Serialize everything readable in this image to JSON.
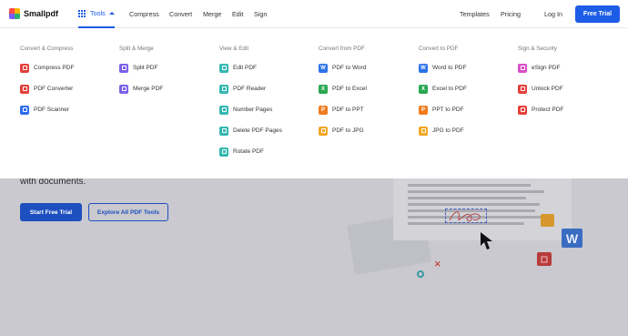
{
  "header": {
    "logo_text": "Smallpdf",
    "tools_label": "Tools",
    "nav": [
      "Compress",
      "Convert",
      "Merge",
      "Edit",
      "Sign"
    ],
    "right_links": [
      "Templates",
      "Pricing",
      "Log In"
    ],
    "cta_label": "Free Trial"
  },
  "menu": {
    "columns": [
      {
        "title": "Convert & Compress",
        "items": [
          {
            "label": "Compress PDF",
            "icon": "compress-icon",
            "color": "red"
          },
          {
            "label": "PDF Converter",
            "icon": "converter-icon",
            "color": "red"
          },
          {
            "label": "PDF Scanner",
            "icon": "scanner-icon",
            "color": "blue"
          }
        ]
      },
      {
        "title": "Split & Merge",
        "items": [
          {
            "label": "Split PDF",
            "icon": "split-icon",
            "color": "purple"
          },
          {
            "label": "Merge PDF",
            "icon": "merge-icon",
            "color": "purple"
          }
        ]
      },
      {
        "title": "View & Edit",
        "items": [
          {
            "label": "Edit PDF",
            "icon": "edit-icon",
            "color": "teal"
          },
          {
            "label": "PDF Reader",
            "icon": "reader-icon",
            "color": "teal"
          },
          {
            "label": "Number Pages",
            "icon": "number-pages-icon",
            "color": "teal"
          },
          {
            "label": "Delete PDF Pages",
            "icon": "delete-pages-icon",
            "color": "teal"
          },
          {
            "label": "Rotate PDF",
            "icon": "rotate-icon",
            "color": "teal"
          }
        ]
      },
      {
        "title": "Convert from PDF",
        "items": [
          {
            "label": "PDF to Word",
            "icon": "word-icon",
            "color": "wblue"
          },
          {
            "label": "PDF to Excel",
            "icon": "excel-icon",
            "color": "green"
          },
          {
            "label": "PDF to PPT",
            "icon": "ppt-icon",
            "color": "orange"
          },
          {
            "label": "PDF to JPG",
            "icon": "jpg-icon",
            "color": "yellow"
          }
        ]
      },
      {
        "title": "Convert to PDF",
        "items": [
          {
            "label": "Word to PDF",
            "icon": "word-icon",
            "color": "wblue"
          },
          {
            "label": "Excel to PDF",
            "icon": "excel-icon",
            "color": "green"
          },
          {
            "label": "PPT to PDF",
            "icon": "ppt-icon",
            "color": "orange"
          },
          {
            "label": "JPG to PDF",
            "icon": "jpg-icon",
            "color": "yellow"
          }
        ]
      },
      {
        "title": "Sign & Security",
        "items": [
          {
            "label": "eSign PDF",
            "icon": "esign-icon",
            "color": "pink"
          },
          {
            "label": "Unlock PDF",
            "icon": "unlock-icon",
            "color": "red"
          },
          {
            "label": "Protect PDF",
            "icon": "protect-icon",
            "color": "red"
          }
        ]
      }
    ]
  },
  "hero": {
    "text": "with documents.",
    "primary_button": "Start Free Trial",
    "secondary_button": "Explore All PDF Tools",
    "word_glyph": "W"
  },
  "colors": {
    "accent": "#1d5ce6",
    "overlay": "#c9c9cf"
  }
}
